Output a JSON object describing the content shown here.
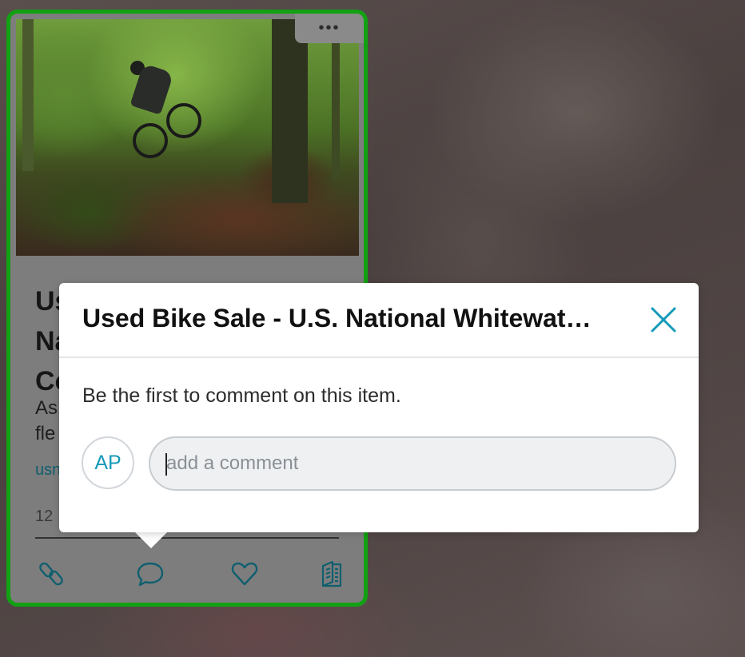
{
  "card": {
    "menu_label": "•••",
    "title_fragment": "Us\nNa\nCo",
    "desc_fragment": "As\nfle",
    "link_fragment": "usn",
    "count_fragment": "12",
    "actions": [
      {
        "name": "link-icon"
      },
      {
        "name": "comment-icon"
      },
      {
        "name": "heart-icon"
      },
      {
        "name": "book-icon"
      }
    ],
    "border_color": "#12a112",
    "accent_color": "#0f5f6f"
  },
  "modal": {
    "title": "Used Bike Sale - U.S. National Whitewat…",
    "empty_message": "Be the first to comment on this item.",
    "avatar_initials": "AP",
    "input_placeholder": "add a comment",
    "close_icon": "close-x-icon",
    "accent_color": "#1499b8"
  }
}
